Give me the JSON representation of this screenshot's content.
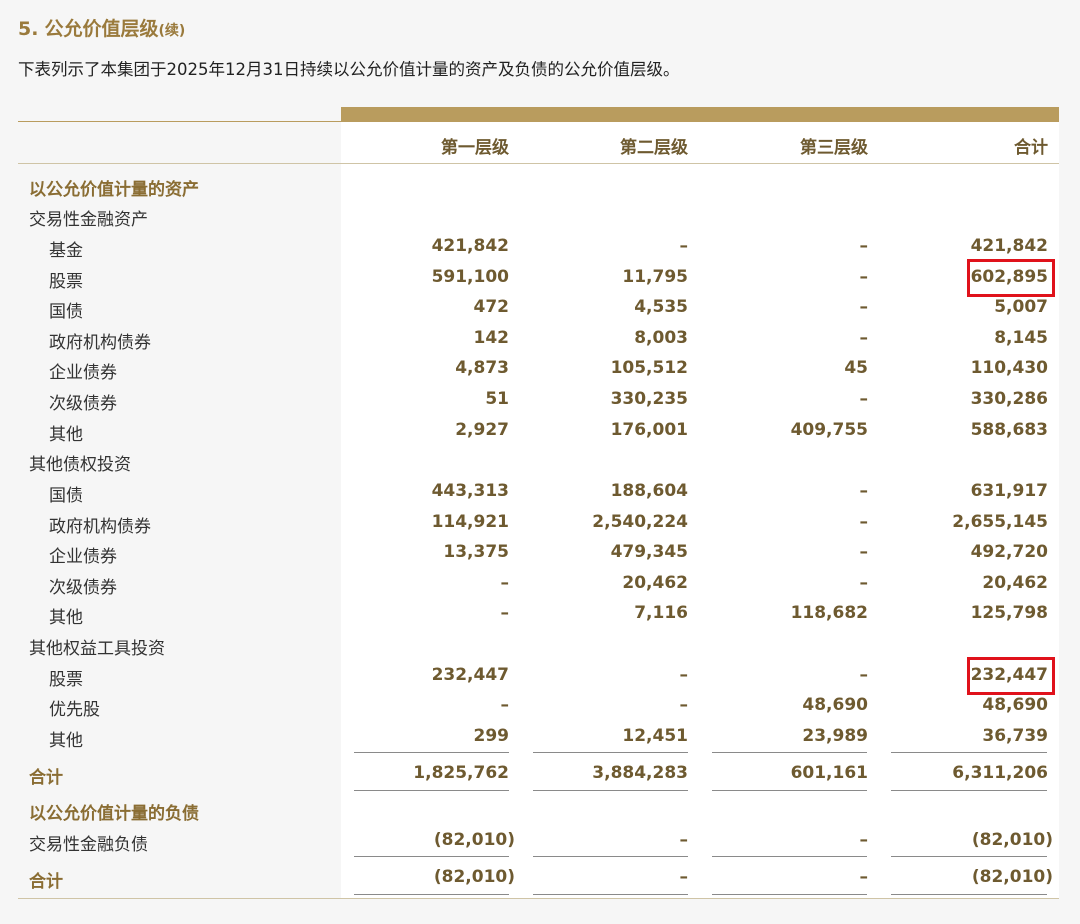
{
  "heading": {
    "number": "5.",
    "title": "公允价值层级",
    "suffix": "(续)"
  },
  "intro": "下表列示了本集团于2025年12月31日持续以公允价值计量的资产及负债的公允价值层级。",
  "columns": [
    "第一层级",
    "第二层级",
    "第三层级",
    "合计"
  ],
  "rows": [
    {
      "label": "以公允价值计量的资产",
      "kind": "section",
      "level": 0,
      "values": [
        "",
        "",
        "",
        ""
      ]
    },
    {
      "label": "交易性金融资产",
      "kind": "group",
      "level": 0,
      "values": [
        "",
        "",
        "",
        ""
      ]
    },
    {
      "label": "基金",
      "kind": "item",
      "level": 1,
      "values": [
        "421,842",
        "–",
        "–",
        "421,842"
      ]
    },
    {
      "label": "股票",
      "kind": "item",
      "level": 1,
      "values": [
        "591,100",
        "11,795",
        "–",
        "602,895"
      ]
    },
    {
      "label": "国债",
      "kind": "item",
      "level": 1,
      "values": [
        "472",
        "4,535",
        "–",
        "5,007"
      ]
    },
    {
      "label": "政府机构债券",
      "kind": "item",
      "level": 1,
      "values": [
        "142",
        "8,003",
        "–",
        "8,145"
      ]
    },
    {
      "label": "企业债券",
      "kind": "item",
      "level": 1,
      "values": [
        "4,873",
        "105,512",
        "45",
        "110,430"
      ]
    },
    {
      "label": "次级债券",
      "kind": "item",
      "level": 1,
      "values": [
        "51",
        "330,235",
        "–",
        "330,286"
      ]
    },
    {
      "label": "其他",
      "kind": "item",
      "level": 1,
      "values": [
        "2,927",
        "176,001",
        "409,755",
        "588,683"
      ]
    },
    {
      "label": "其他债权投资",
      "kind": "group",
      "level": 0,
      "values": [
        "",
        "",
        "",
        ""
      ]
    },
    {
      "label": "国债",
      "kind": "item",
      "level": 1,
      "values": [
        "443,313",
        "188,604",
        "–",
        "631,917"
      ]
    },
    {
      "label": "政府机构债券",
      "kind": "item",
      "level": 1,
      "values": [
        "114,921",
        "2,540,224",
        "–",
        "2,655,145"
      ]
    },
    {
      "label": "企业债券",
      "kind": "item",
      "level": 1,
      "values": [
        "13,375",
        "479,345",
        "–",
        "492,720"
      ]
    },
    {
      "label": "次级债券",
      "kind": "item",
      "level": 1,
      "values": [
        "–",
        "20,462",
        "–",
        "20,462"
      ]
    },
    {
      "label": "其他",
      "kind": "item",
      "level": 1,
      "values": [
        "–",
        "7,116",
        "118,682",
        "125,798"
      ]
    },
    {
      "label": "其他权益工具投资",
      "kind": "group",
      "level": 0,
      "values": [
        "",
        "",
        "",
        ""
      ]
    },
    {
      "label": "股票",
      "kind": "item",
      "level": 1,
      "values": [
        "232,447",
        "–",
        "–",
        "232,447"
      ]
    },
    {
      "label": "优先股",
      "kind": "item",
      "level": 1,
      "values": [
        "–",
        "–",
        "48,690",
        "48,690"
      ]
    },
    {
      "label": "其他",
      "kind": "item",
      "level": 1,
      "values": [
        "299",
        "12,451",
        "23,989",
        "36,739"
      ]
    },
    {
      "label": "合计",
      "kind": "total",
      "level": 0,
      "values": [
        "1,825,762",
        "3,884,283",
        "601,161",
        "6,311,206"
      ]
    },
    {
      "label": "以公允价值计量的负债",
      "kind": "section",
      "level": 0,
      "values": [
        "",
        "",
        "",
        ""
      ]
    },
    {
      "label": "交易性金融负债",
      "kind": "group",
      "level": 0,
      "values": [
        "(82,010)",
        "–",
        "–",
        "(82,010)"
      ]
    },
    {
      "label": "合计",
      "kind": "total",
      "level": 0,
      "values": [
        "(82,010)",
        "–",
        "–",
        "(82,010)"
      ]
    }
  ],
  "highlight_color": "#e0121b",
  "accent_color": "#b99c5e"
}
